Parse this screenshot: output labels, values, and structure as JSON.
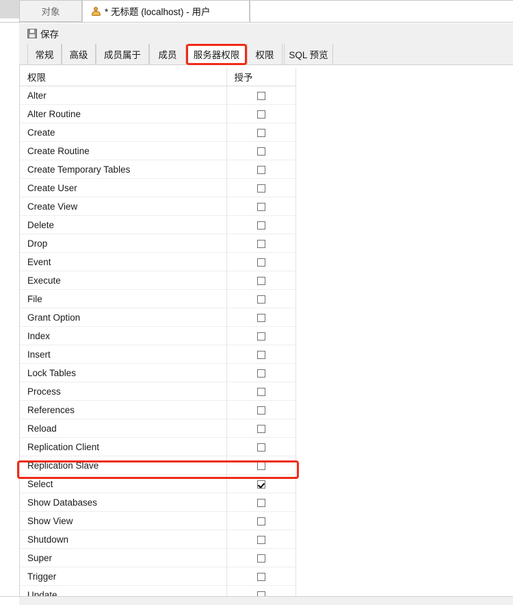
{
  "window": {
    "tabs": [
      {
        "label": "对象",
        "active": false,
        "icon": null
      },
      {
        "label": "* 无标题 (localhost) - 用户",
        "active": true,
        "icon": "user-icon"
      }
    ]
  },
  "toolbar": {
    "save_label": "保存",
    "save_icon": "save-floppy-icon"
  },
  "inner_tabs": [
    {
      "label": "常规",
      "selected": false
    },
    {
      "label": "高级",
      "selected": false
    },
    {
      "label": "成员属于",
      "selected": false
    },
    {
      "label": "成员",
      "selected": false
    },
    {
      "label": "服务器权限",
      "selected": true
    },
    {
      "label": "权限",
      "selected": false
    },
    {
      "label": "SQL 预览",
      "selected": false
    }
  ],
  "table": {
    "columns": [
      "权限",
      "授予"
    ],
    "rows": [
      {
        "privilege": "Alter",
        "granted": false
      },
      {
        "privilege": "Alter Routine",
        "granted": false
      },
      {
        "privilege": "Create",
        "granted": false
      },
      {
        "privilege": "Create Routine",
        "granted": false
      },
      {
        "privilege": "Create Temporary Tables",
        "granted": false
      },
      {
        "privilege": "Create User",
        "granted": false
      },
      {
        "privilege": "Create View",
        "granted": false
      },
      {
        "privilege": "Delete",
        "granted": false
      },
      {
        "privilege": "Drop",
        "granted": false
      },
      {
        "privilege": "Event",
        "granted": false
      },
      {
        "privilege": "Execute",
        "granted": false
      },
      {
        "privilege": "File",
        "granted": false
      },
      {
        "privilege": "Grant Option",
        "granted": false
      },
      {
        "privilege": "Index",
        "granted": false
      },
      {
        "privilege": "Insert",
        "granted": false
      },
      {
        "privilege": "Lock Tables",
        "granted": false
      },
      {
        "privilege": "Process",
        "granted": false
      },
      {
        "privilege": "References",
        "granted": false
      },
      {
        "privilege": "Reload",
        "granted": false
      },
      {
        "privilege": "Replication Client",
        "granted": false
      },
      {
        "privilege": "Replication Slave",
        "granted": false
      },
      {
        "privilege": "Select",
        "granted": true
      },
      {
        "privilege": "Show Databases",
        "granted": false
      },
      {
        "privilege": "Show View",
        "granted": false
      },
      {
        "privilege": "Shutdown",
        "granted": false
      },
      {
        "privilege": "Super",
        "granted": false
      },
      {
        "privilege": "Trigger",
        "granted": false
      },
      {
        "privilege": "Update",
        "granted": false
      }
    ]
  },
  "annotations": {
    "color": "#ef2b16",
    "boxes": [
      {
        "target": "服务器权限"
      },
      {
        "target": "Select"
      }
    ]
  }
}
